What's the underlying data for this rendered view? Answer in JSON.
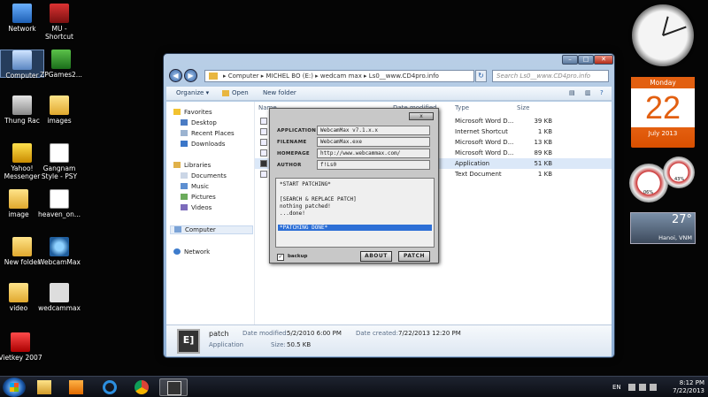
{
  "desktop": {
    "icons": [
      {
        "label": "Network",
        "icon": "network-icon"
      },
      {
        "label": "MU -\nShortcut",
        "icon": "shortcut-icon"
      },
      {
        "label": "Computer",
        "icon": "computer-icon"
      },
      {
        "label": "ZPGames2...",
        "icon": "game-icon"
      },
      {
        "label": "Thung Rac",
        "icon": "recycle-bin-icon"
      },
      {
        "label": "images",
        "icon": "folder-icon"
      },
      {
        "label": "Yahoo!\nMessenger",
        "icon": "messenger-icon"
      },
      {
        "label": "Gangnam\nStyle - PSY",
        "icon": "media-file-icon"
      },
      {
        "label": "image",
        "icon": "folder-icon"
      },
      {
        "label": "heaven_on...",
        "icon": "document-icon"
      },
      {
        "label": "New folder",
        "icon": "folder-icon"
      },
      {
        "label": "WebcamMax",
        "icon": "webcam-icon"
      },
      {
        "label": "video",
        "icon": "folder-icon"
      },
      {
        "label": "wedcammax",
        "icon": "file-icon"
      },
      {
        "label": "Vietkey 2007",
        "icon": "keyboard-app-icon"
      }
    ]
  },
  "gadgets": {
    "calendar": {
      "weekday": "Monday",
      "day": "22",
      "month_year": "July 2013"
    },
    "meter": {
      "cpu": "06%",
      "ram": "43%"
    },
    "weather": {
      "temp": "27°",
      "location": "Hanoi, VNM"
    }
  },
  "explorer": {
    "address_path": "▸ Computer ▸ MICHEL BO (E:) ▸ wedcam max ▸ Ls0__www.CD4pro.info",
    "search_placeholder": "Search Ls0__www.CD4pro.info",
    "toolbar": {
      "organize": "Organize ▾",
      "open": "Open",
      "new_folder": "New folder"
    },
    "nav": {
      "favorites": "Favorites",
      "desktop": "Desktop",
      "recent": "Recent Places",
      "downloads": "Downloads",
      "libraries": "Libraries",
      "documents": "Documents",
      "music": "Music",
      "pictures": "Pictures",
      "videos": "Videos",
      "computer": "Computer",
      "network": "Network"
    },
    "columns": {
      "name": "Name",
      "date": "Date modified",
      "type": "Type",
      "size": "Size"
    },
    "files": [
      {
        "type": "Microsoft Word D...",
        "size": "39 KB"
      },
      {
        "type": "Internet Shortcut",
        "size": "1 KB"
      },
      {
        "type": "Microsoft Word D...",
        "size": "13 KB"
      },
      {
        "type": "Microsoft Word D...",
        "size": "89 KB"
      },
      {
        "type": "Application",
        "size": "51 KB"
      },
      {
        "type": "Text Document",
        "size": "1 KB"
      }
    ],
    "details": {
      "name": "patch",
      "kind": "Application",
      "date_modified_label": "Date modified:",
      "date_modified": "5/2/2010 6:00 PM",
      "date_created_label": "Date created:",
      "date_created": "7/22/2013 12:20 PM",
      "size_label": "Size:",
      "size": "50.5 KB",
      "thumb_text": "E]"
    }
  },
  "patcher": {
    "close_label": "x",
    "fields": [
      {
        "label": "APPLICATION",
        "value": "WebcamMax v7.1.x.x"
      },
      {
        "label": "FILENAME",
        "value": "WebcamMax.exe"
      },
      {
        "label": "HOMEPAGE",
        "value": "http://www.webcammax.com/"
      },
      {
        "label": "AUTHOR",
        "value": "f!Ls0"
      }
    ],
    "log": [
      "*START PATCHING*",
      "",
      "[SEARCH & REPLACE PATCH]",
      "nothing patched!",
      "...done!",
      "",
      "*PATCHING DONE*"
    ],
    "backup_label": "backup",
    "about_label": "ABOUT",
    "patch_label": "PATCH"
  },
  "taskbar": {
    "language": "EN",
    "time": "8:12 PM",
    "date": "7/22/2013"
  }
}
